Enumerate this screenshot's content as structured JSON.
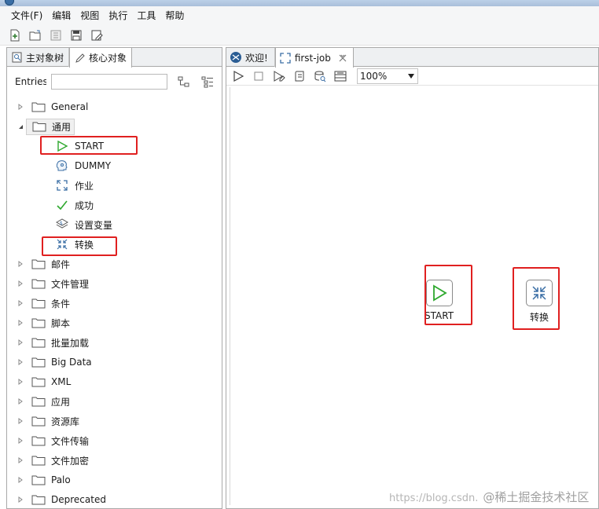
{
  "menu": [
    "文件(F)",
    "编辑",
    "视图",
    "执行",
    "工具",
    "帮助"
  ],
  "left_panel": {
    "tabs": [
      {
        "label": "主对象树"
      },
      {
        "label": "核心对象"
      }
    ],
    "search_label": "Entries",
    "search_value": ""
  },
  "tree": {
    "general": "General",
    "tongyong": "通用",
    "children": [
      "START",
      "DUMMY",
      "作业",
      "成功",
      "设置变量",
      "转换"
    ],
    "folders": [
      "邮件",
      "文件管理",
      "条件",
      "脚本",
      "批量加载",
      "Big Data",
      "XML",
      "应用",
      "资源库",
      "文件传输",
      "文件加密",
      "Palo",
      "Deprecated"
    ]
  },
  "right_panel": {
    "tabs": [
      {
        "label": "欢迎!"
      },
      {
        "label": "first-job"
      }
    ],
    "zoom": "100%"
  },
  "canvas": {
    "start_label": "START",
    "trans_label": "转换"
  },
  "watermark": {
    "url": "https://blog.csdn.",
    "brand": "@稀土掘金技术社区"
  }
}
